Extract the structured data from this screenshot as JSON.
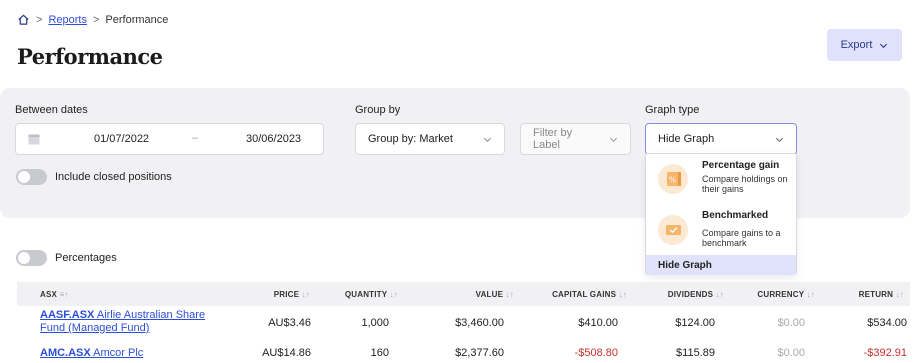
{
  "breadcrumb": {
    "reports": "Reports",
    "current": "Performance",
    "sep": ">"
  },
  "page": {
    "title": "Performance"
  },
  "export_button": {
    "label": "Export"
  },
  "filters": {
    "between_dates_label": "Between dates",
    "date_from": "01/07/2022",
    "date_separator": "–",
    "date_to": "30/06/2023",
    "group_by_label": "Group by",
    "group_by_value": "Group by: Market",
    "filter_label_placeholder": "Filter by Label",
    "graph_type_label": "Graph type",
    "graph_type_value": "Hide Graph",
    "include_closed_label": "Include closed positions"
  },
  "graph_dropdown": {
    "options": [
      {
        "title": "Percentage gain",
        "desc": "Compare holdings on their gains",
        "icon": "percentage-icon"
      },
      {
        "title": "Benchmarked",
        "desc": "Compare gains to a benchmark",
        "icon": "benchmark-check-icon"
      }
    ],
    "selected": "Hide Graph"
  },
  "percentages_toggle": {
    "label": "Percentages"
  },
  "table": {
    "headers": {
      "asx": "ASX",
      "price": "PRICE",
      "quantity": "QUANTITY",
      "value": "VALUE",
      "capital_gains": "CAPITAL GAINS",
      "dividends": "DIVIDENDS",
      "currency": "CURRENCY",
      "return": "RETURN"
    },
    "sort_glyph": "↓↑",
    "asx_sort_glyph": "≡↑",
    "rows": [
      {
        "ticker": "AASF.ASX",
        "name_line1": " Airlie Australian Share",
        "name_line2": "Fund (Managed Fund)",
        "price": "AU$3.46",
        "quantity": "1,000",
        "value": "$3,460.00",
        "capital_gains": "$410.00",
        "dividends": "$124.00",
        "currency": "$0.00",
        "return": "$534.00"
      },
      {
        "ticker": "AMC.ASX",
        "name_line1": " Amcor Plc",
        "name_line2": "",
        "price": "AU$14.86",
        "quantity": "160",
        "value": "$2,377.60",
        "capital_gains": "-$508.80",
        "dividends": "$115.89",
        "currency": "$0.00",
        "return": "-$392.91"
      }
    ]
  },
  "colors": {
    "accent": "#2b4fd6",
    "negative": "#c8322c",
    "panel": "#f1f1f4",
    "highlight": "#dfe2fa"
  }
}
